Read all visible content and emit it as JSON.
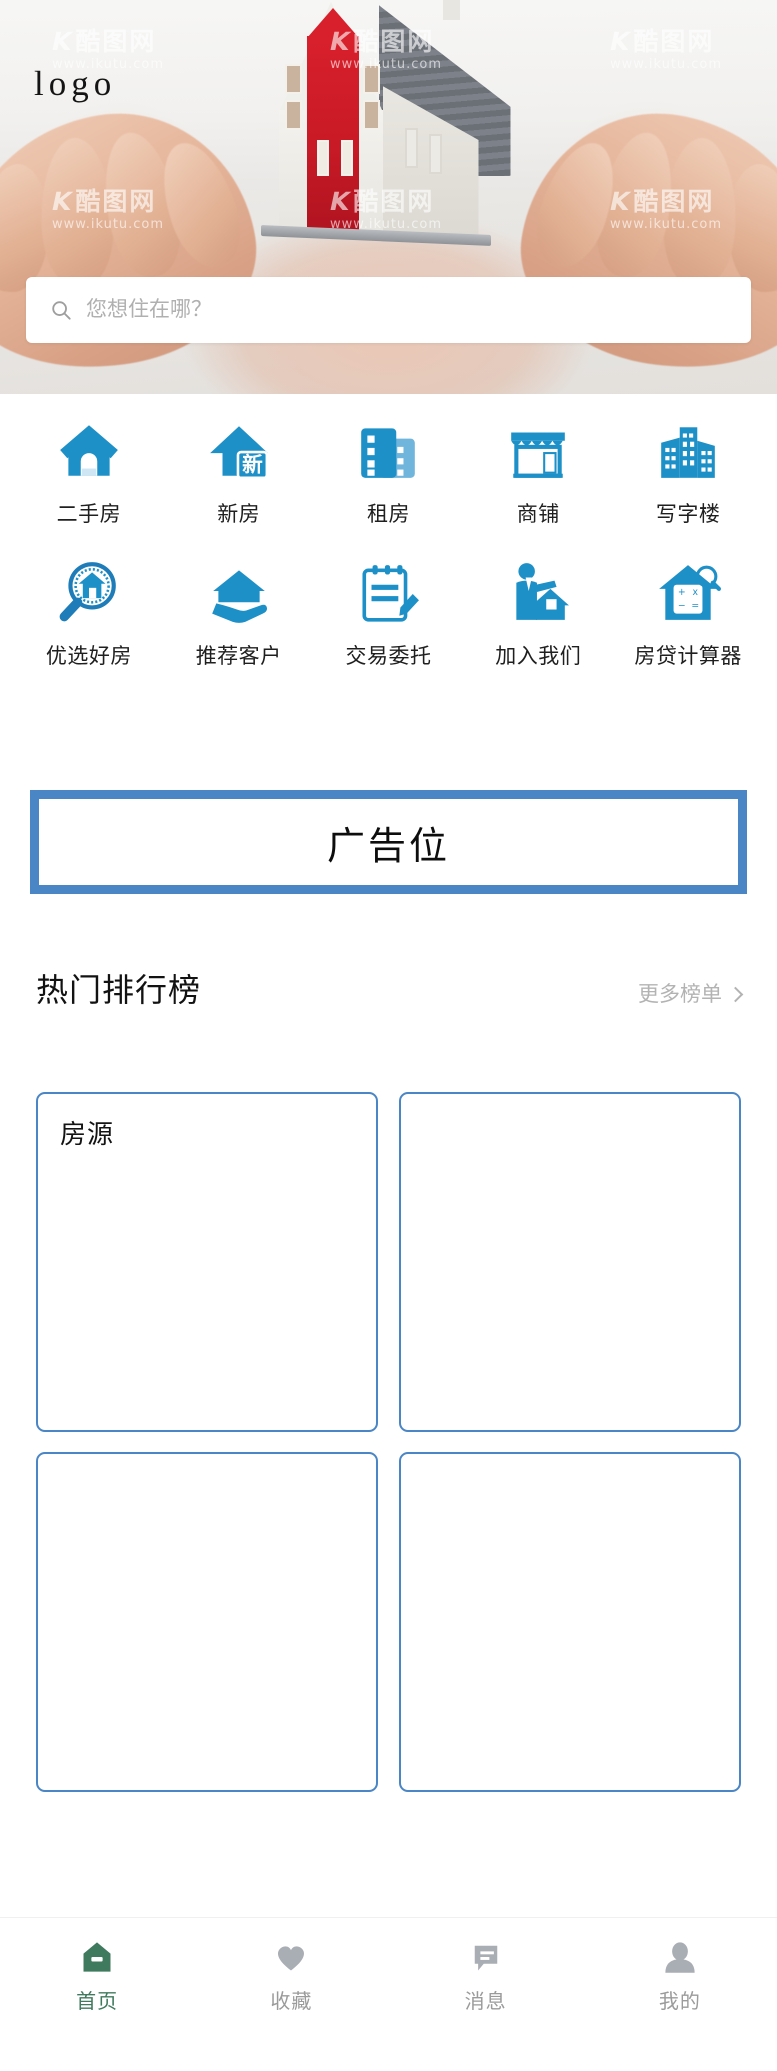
{
  "brand": {
    "logo_text": "logo",
    "accent_blue": "#1e90c8",
    "border_blue": "#4a86c5",
    "active_green": "#3f7a5e",
    "inactive_gray": "#9b9b9b"
  },
  "hero": {
    "alt": "hands-holding-house-model",
    "watermark_text": "酷图网",
    "watermark_url": "www.ikutu.com"
  },
  "search": {
    "placeholder": "您想住在哪？",
    "value": "",
    "icon": "search-icon"
  },
  "categories": [
    {
      "label": "二手房",
      "icon": "house-icon"
    },
    {
      "label": "新房",
      "icon": "new-house-icon"
    },
    {
      "label": "租房",
      "icon": "rental-building-icon"
    },
    {
      "label": "商铺",
      "icon": "shop-icon"
    },
    {
      "label": "写字楼",
      "icon": "office-building-icon"
    },
    {
      "label": "优选好房",
      "icon": "magnifier-house-icon"
    },
    {
      "label": "推荐客户",
      "icon": "hand-house-icon"
    },
    {
      "label": "交易委托",
      "icon": "contract-pen-icon"
    },
    {
      "label": "加入我们",
      "icon": "agent-person-icon"
    },
    {
      "label": "房贷计算器",
      "icon": "calculator-house-icon"
    }
  ],
  "ad": {
    "text": "广告位"
  },
  "ranking": {
    "title": "热门排行榜",
    "more_label": "更多榜单",
    "more_icon": "chevron-right-icon",
    "cards": [
      {
        "label": "房源"
      },
      {
        "label": ""
      },
      {
        "label": ""
      },
      {
        "label": ""
      }
    ]
  },
  "tabbar": [
    {
      "label": "首页",
      "icon": "home-icon",
      "active": true
    },
    {
      "label": "收藏",
      "icon": "heart-icon",
      "active": false
    },
    {
      "label": "消息",
      "icon": "message-icon",
      "active": false
    },
    {
      "label": "我的",
      "icon": "person-icon",
      "active": false
    }
  ]
}
